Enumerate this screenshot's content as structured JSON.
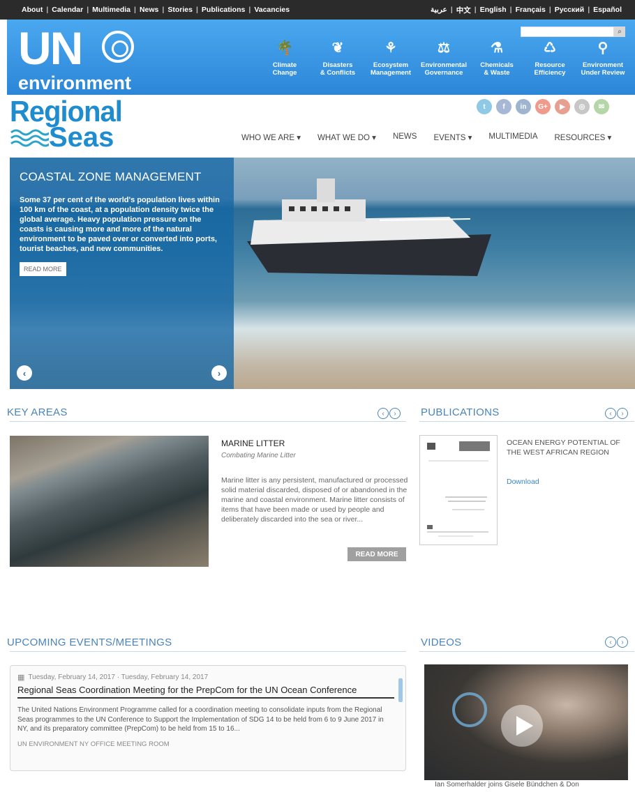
{
  "topnav": {
    "links": [
      "About",
      "Calendar",
      "Multimedia",
      "News",
      "Stories",
      "Publications",
      "Vacancies"
    ],
    "languages": [
      "عربية",
      "中文",
      "English",
      "Français",
      "Русский",
      "Español"
    ]
  },
  "unbar": {
    "logo_un": "UN",
    "logo_env": "environment",
    "search_placeholder": "",
    "search_icon": "search-icon",
    "themes": [
      {
        "line1": "Climate",
        "line2": "Change",
        "icon": "🌴"
      },
      {
        "line1": "Disasters",
        "line2": "& Conflicts",
        "icon": "❦"
      },
      {
        "line1": "Ecosystem",
        "line2": "Management",
        "icon": "⚘"
      },
      {
        "line1": "Environmental",
        "line2": "Governance",
        "icon": "⚖"
      },
      {
        "line1": "Chemicals",
        "line2": "& Waste",
        "icon": "⚗"
      },
      {
        "line1": "Resource",
        "line2": "Efficiency",
        "icon": "♺"
      },
      {
        "line1": "Environment",
        "line2": "Under Review",
        "icon": "⚲"
      }
    ]
  },
  "regional_seas": {
    "logo_line1": "Regional",
    "logo_line2": "Seas",
    "social": [
      {
        "name": "twitter",
        "label": "t",
        "color": "#8ecae6"
      },
      {
        "name": "facebook",
        "label": "f",
        "color": "#a7b8d6"
      },
      {
        "name": "linkedin",
        "label": "in",
        "color": "#9fb4cf"
      },
      {
        "name": "google-plus",
        "label": "G+",
        "color": "#ef9a8a"
      },
      {
        "name": "youtube",
        "label": "▶",
        "color": "#e79f8f"
      },
      {
        "name": "instagram",
        "label": "◎",
        "color": "#c7c7c7"
      },
      {
        "name": "wechat",
        "label": "✉",
        "color": "#b5d6a7"
      }
    ],
    "nav": [
      "WHO WE ARE ▾",
      "WHAT WE DO ▾",
      "NEWS",
      "EVENTS ▾",
      "MULTIMEDIA",
      "RESOURCES ▾"
    ]
  },
  "hero": {
    "title": "COASTAL ZONE MANAGEMENT",
    "text": "Some 37 per cent of the world's population lives within 100 km of the coast, at a population density twice the global average. Heavy population pressure on the coasts is causing more and more of the natural environment to be paved over or converted into ports, tourist beaches, and new communities.",
    "button": "READ MORE",
    "prev": "‹",
    "next": "›"
  },
  "key_areas": {
    "heading": "KEY AREAS",
    "title": "MARINE LITTER",
    "subtitle": "Combating Marine Litter",
    "text": "Marine litter is any persistent, manufactured or processed solid material discarded, disposed of or abandoned in the marine and coastal environment. Marine litter consists of items that have been made or used by people and deliberately discarded into the sea or river...",
    "button": "READ MORE"
  },
  "publications": {
    "heading": "PUBLICATIONS",
    "title": "OCEAN ENERGY POTENTIAL OF THE WEST AFRICAN REGION",
    "download": "Download"
  },
  "events": {
    "heading": "UPCOMING EVENTS/MEETINGS",
    "date": "Tuesday, February 14, 2017 · Tuesday, February 14, 2017",
    "title": "Regional Seas Coordination Meeting for the PrepCom for the UN Ocean Conference",
    "text": "The United Nations Environment Programme called for a coordination meeting to consolidate inputs from the Regional Seas programmes to the UN Conference to Support the Implementation of SDG 14 to be held from 6 to 9 June 2017 in NY, and its preparatory committee (PrepCom) to be held from 15 to 16...",
    "location": "UN ENVIRONMENT NY OFFICE MEETING ROOM"
  },
  "videos": {
    "heading": "VIDEOS",
    "caption": "Ian Somerhalder joins Gisele Bündchen & Don"
  },
  "pager": {
    "prev": "‹",
    "next": "›"
  }
}
